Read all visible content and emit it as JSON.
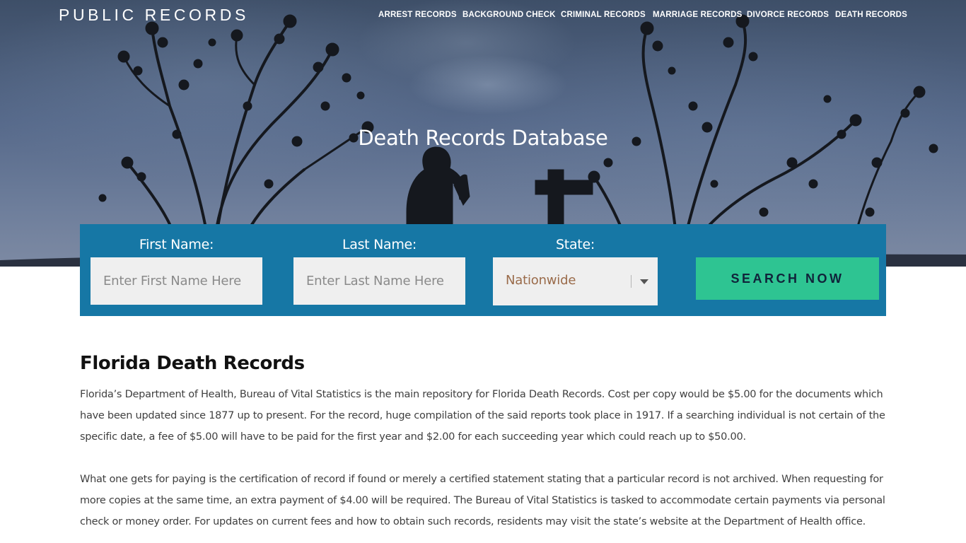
{
  "header": {
    "logo": "PUBLIC RECORDS",
    "nav": [
      {
        "label": "ARREST RECORDS"
      },
      {
        "label": "BACKGROUND CHECK"
      },
      {
        "label": "CRIMINAL RECORDS"
      },
      {
        "label": "MARRIAGE RECORDS"
      },
      {
        "label": "DIVORCE RECORDS"
      },
      {
        "label": "DEATH RECORDS"
      }
    ]
  },
  "hero": {
    "title": "Death Records Database"
  },
  "search": {
    "first_name_label": "First Name:",
    "first_name_placeholder": "Enter First Name Here",
    "last_name_label": "Last Name:",
    "last_name_placeholder": "Enter Last Name Here",
    "state_label": "State:",
    "state_value": "Nationwide",
    "button_label": "SEARCH NOW"
  },
  "article": {
    "title": "Florida Death Records",
    "paragraphs": [
      "Florida’s Department of Health, Bureau of Vital Statistics is the main repository for Florida Death Records. Cost per copy would be $5.00 for the documents which have been updated since 1877 up to present. For the record, huge compilation of the said reports took place in 1917. If a searching individual is not certain of the specific date, a fee of $5.00 will have to be paid for the first year and $2.00 for each succeeding year which could reach up to $50.00.",
      "What one gets for paying is the certification of record if found or merely a certified statement stating that a particular record is not archived. When requesting for more copies at the same time, an extra payment of $4.00 will be required. The Bureau of Vital Statistics is tasked to accommodate certain payments via personal check or money order. For updates on current fees and how to obtain such records, residents may visit the state’s website at the Department of Health office."
    ]
  },
  "colors": {
    "panel": "#1677a5",
    "button": "#2ec492",
    "hero_sky": "#56698a"
  }
}
